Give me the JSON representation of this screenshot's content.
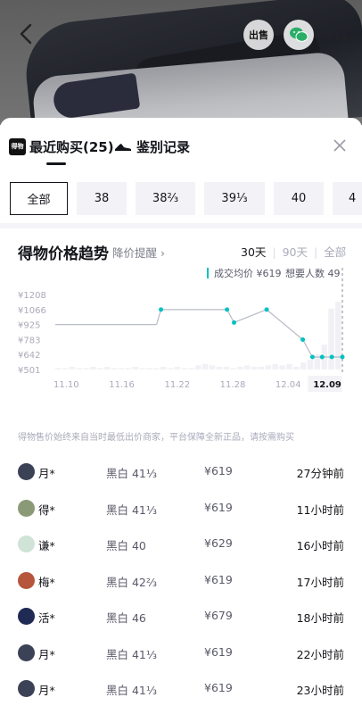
{
  "header": {
    "sell_badge": "出售",
    "more": "···"
  },
  "tabs": [
    {
      "label": "最近购买(25)",
      "logo_text": "得物"
    },
    {
      "label": "鉴别记录"
    }
  ],
  "sizes": [
    "全部",
    "38",
    "38⅔",
    "39⅓",
    "40",
    "4"
  ],
  "trend": {
    "title": "得物价格趋势",
    "alert": "降价提醒 ›",
    "ranges": [
      "30天",
      "90天",
      "全部"
    ]
  },
  "chart_data": {
    "type": "line",
    "legend": [
      {
        "label": "成交均价 ¥619"
      },
      {
        "label": "想要人数 49"
      }
    ],
    "ylabels": [
      "¥1208",
      "¥1066",
      "¥925",
      "¥783",
      "¥642",
      "¥501"
    ],
    "ylim": [
      501,
      1208
    ],
    "xlabels": [
      "11.10",
      "11.16",
      "11.22",
      "11.28",
      "12.04",
      "12.09"
    ],
    "price_points": [
      {
        "x": 0,
        "y": 925
      },
      {
        "x": 11.5,
        "y": 925
      },
      {
        "x": 12.0,
        "y": 1066,
        "dot": true
      },
      {
        "x": 19.5,
        "y": 1066,
        "dot": true
      },
      {
        "x": 20.3,
        "y": 944,
        "dot": true
      },
      {
        "x": 24.0,
        "y": 1066,
        "dot": true
      },
      {
        "x": 28.1,
        "y": 783,
        "dot": true
      },
      {
        "x": 29.2,
        "y": 619,
        "dot": true
      },
      {
        "x": 30.3,
        "y": 619,
        "dot": true
      },
      {
        "x": 31.4,
        "y": 619,
        "dot": true
      },
      {
        "x": 32.6,
        "y": 619,
        "dot": true
      }
    ],
    "bars": [
      1,
      1,
      2,
      1,
      1,
      2,
      1,
      2,
      1,
      1,
      1,
      2,
      1,
      1,
      1,
      2,
      1,
      2,
      1,
      1,
      3,
      4,
      3,
      2,
      2,
      1,
      2,
      3,
      2,
      2,
      3,
      4,
      3,
      4,
      2,
      5,
      7,
      11,
      18,
      44,
      49
    ]
  },
  "note": "得物售价始终来自当时最低出价商家，平台保障全新正品，请按需购买",
  "records": [
    {
      "user": "月*",
      "spec": "黑白 41⅓",
      "price": "¥619",
      "time": "27分钟前",
      "avatar": "#3b4256"
    },
    {
      "user": "得*",
      "spec": "黑白 41⅓",
      "price": "¥619",
      "time": "11小时前",
      "avatar": "#8a9a76"
    },
    {
      "user": "谦*",
      "spec": "黑白 40",
      "price": "¥629",
      "time": "16小时前",
      "avatar": "#cfe3d6"
    },
    {
      "user": "梅*",
      "spec": "黑白 42⅔",
      "price": "¥619",
      "time": "17小时前",
      "avatar": "#b5553c"
    },
    {
      "user": "活*",
      "spec": "黑白 46",
      "price": "¥679",
      "time": "18小时前",
      "avatar": "#1f2a55"
    },
    {
      "user": "月*",
      "spec": "黑白 41⅓",
      "price": "¥619",
      "time": "22小时前",
      "avatar": "#3b4256"
    },
    {
      "user": "月*",
      "spec": "黑白 41⅓",
      "price": "¥619",
      "time": "23小时前",
      "avatar": "#3b4256"
    }
  ],
  "colors": {
    "accent": "#01c2c3",
    "line_gray": "#b8bcc6",
    "bar": "#f1f1f5"
  }
}
